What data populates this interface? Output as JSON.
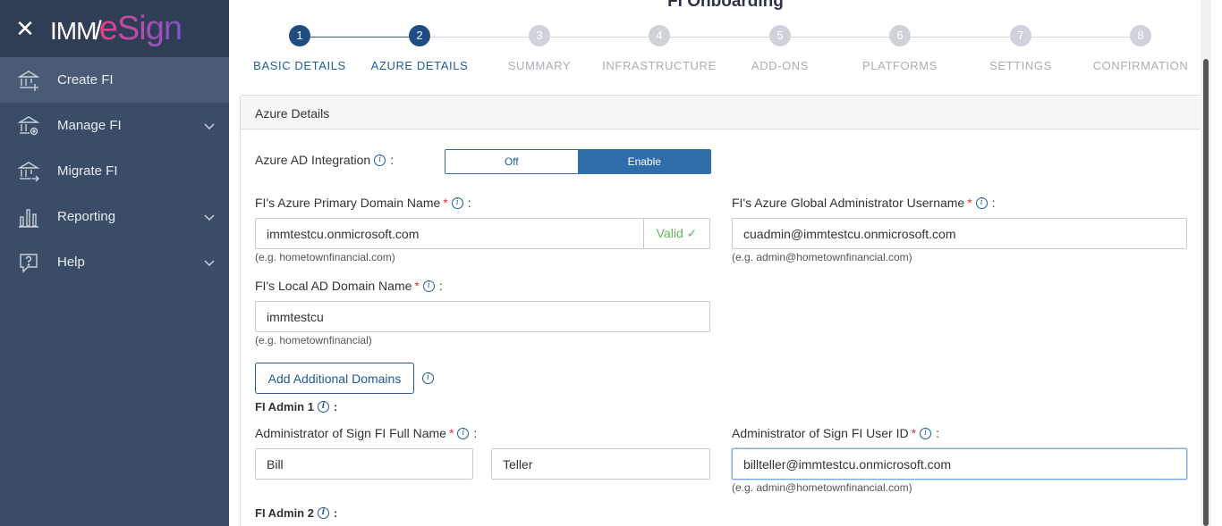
{
  "app": {
    "logo_imm": "IMM",
    "logo_slash": "/",
    "logo_esign": "eSign"
  },
  "sidebar": {
    "items": [
      {
        "label": "Create FI",
        "icon": "bank-add-icon",
        "active": true
      },
      {
        "label": "Manage FI",
        "icon": "bank-settings-icon",
        "has_submenu": true
      },
      {
        "label": "Migrate FI",
        "icon": "bank-migrate-icon"
      },
      {
        "label": "Reporting",
        "icon": "bar-chart-icon",
        "has_submenu": true
      },
      {
        "label": "Help",
        "icon": "help-icon",
        "has_submenu": true
      }
    ]
  },
  "page": {
    "title": "FI Onboarding"
  },
  "stepper": {
    "steps": [
      {
        "number": "1",
        "label": "BASIC DETAILS",
        "state": "active"
      },
      {
        "number": "2",
        "label": "AZURE DETAILS",
        "state": "active"
      },
      {
        "number": "3",
        "label": "SUMMARY",
        "state": "pending"
      },
      {
        "number": "4",
        "label": "INFRASTRUCTURE",
        "state": "pending"
      },
      {
        "number": "5",
        "label": "ADD-ONS",
        "state": "pending"
      },
      {
        "number": "6",
        "label": "PLATFORMS",
        "state": "pending"
      },
      {
        "number": "7",
        "label": "SETTINGS",
        "state": "pending"
      },
      {
        "number": "8",
        "label": "CONFIRMATION",
        "state": "pending"
      }
    ]
  },
  "azure": {
    "header": "Azure Details",
    "integration_label": "Azure AD Integration",
    "toggle_off": "Off",
    "toggle_on": "Enable",
    "toggle_value": "Enable",
    "primary_domain_label": "FI's Azure Primary Domain Name",
    "primary_domain_value": "immtestcu.onmicrosoft.com",
    "primary_domain_status": "Valid ✓",
    "primary_domain_hint": "(e.g. hometownfinancial.com)",
    "global_admin_label": "FI's Azure Global Administrator Username",
    "global_admin_value": "cuadmin@immtestcu.onmicrosoft.com",
    "global_admin_hint": "(e.g. admin@hometownfinancial.com)",
    "local_domain_label": "FI's Local AD Domain Name",
    "local_domain_value": "immtestcu",
    "local_domain_hint": "(e.g. hometownfinancial)",
    "add_domains_button": "Add Additional Domains",
    "admin1_title": "FI Admin 1",
    "admin_fullname_label": "Administrator of Sign FI Full Name",
    "admin1_first_name": "Bill",
    "admin1_last_name": "Teller",
    "admin_userid_label": "Administrator of Sign FI User ID",
    "admin1_userid": "billteller@immtestcu.onmicrosoft.com",
    "admin_userid_hint": "(e.g. admin@hometownfinancial.com)",
    "admin2_title": "FI Admin 2"
  },
  "colors": {
    "sidebar_bg": "#3b4c66",
    "sidebar_header_bg": "#2f3d55",
    "primary": "#2f6ea8",
    "step_active": "#1f4d82",
    "valid": "#5cb85c",
    "required": "#d9363e"
  }
}
